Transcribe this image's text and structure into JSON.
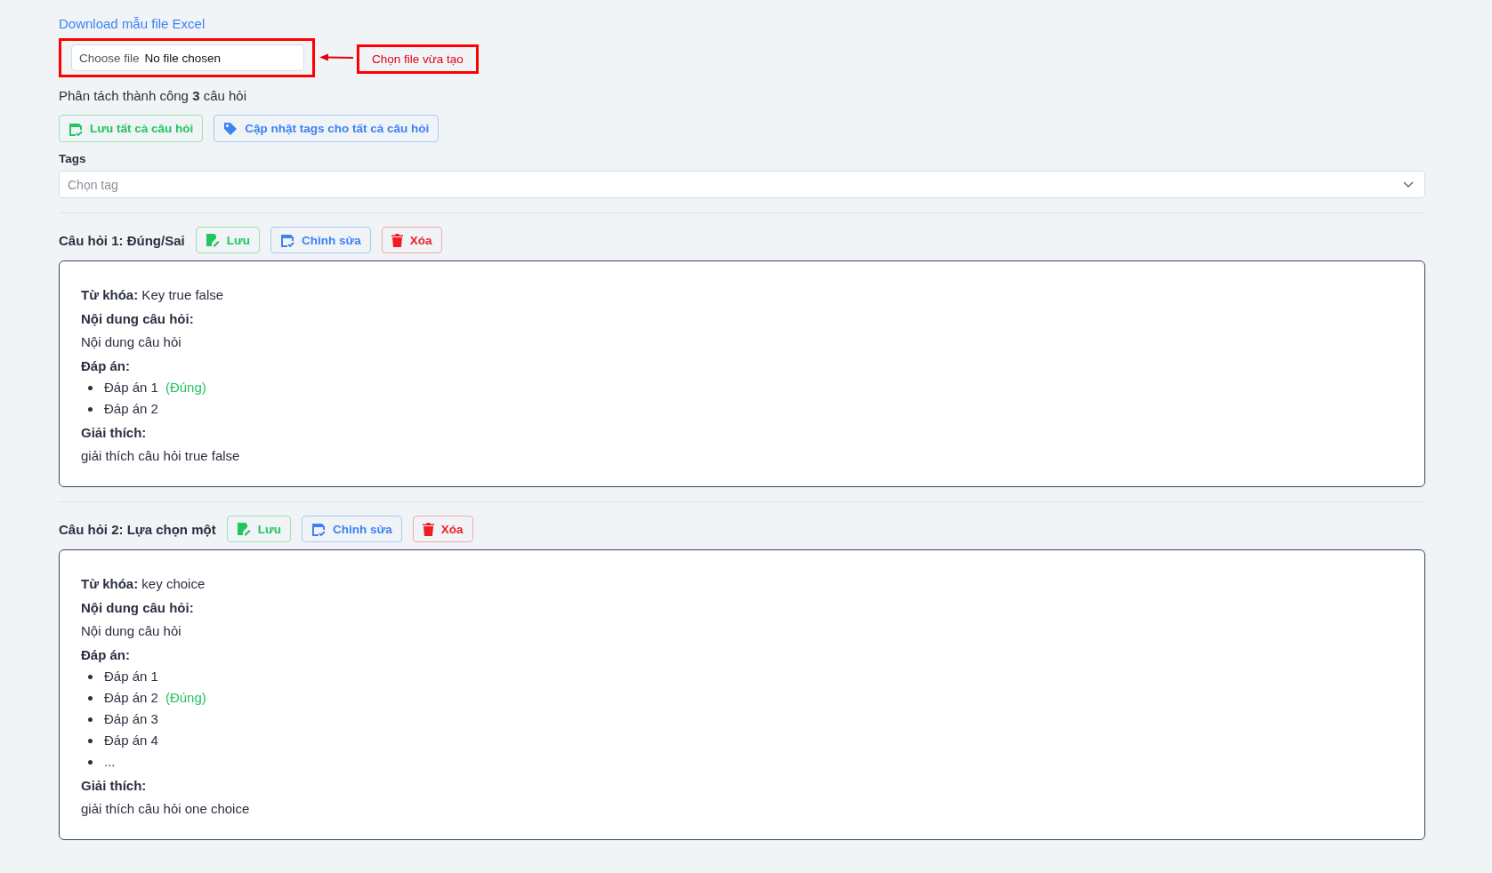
{
  "download_link": "Download mẫu file Excel",
  "file_input": {
    "button": "Choose file",
    "value": "No file chosen"
  },
  "annotation": {
    "text": "Chọn file vừa tạo"
  },
  "result_text": "Phân tách thành công **3** câu hỏi",
  "bulk_buttons": [
    {
      "kind": "save",
      "label": "Lưu tất cả câu hỏi"
    },
    {
      "kind": "tag",
      "label": "Cập nhật tags cho tất cả câu hỏi"
    }
  ],
  "tags": {
    "label": "Tags",
    "placeholder": "Chọn tag"
  },
  "questions": [
    {
      "title": "Câu hỏi 1: Đúng/Sai",
      "buttons": [
        {
          "kind": "save",
          "label": "Lưu"
        },
        {
          "kind": "edit",
          "label": "Chỉnh sửa"
        },
        {
          "kind": "delete",
          "label": "Xóa"
        }
      ],
      "keyword": "**Từ khóa:** Key true false",
      "content_label": "Nội dung câu hỏi:",
      "content": "Nội dung câu hỏi",
      "answers_label": "Đáp án:",
      "answers": [
        {
          "text": "Đáp án 1",
          "tag": "(Đúng)"
        },
        {
          "text": "Đáp án 2"
        }
      ],
      "explanation_label": "Giải thích:",
      "explanation": "giải thích câu hỏi true false"
    },
    {
      "title": "Câu hỏi 2: Lựa chọn một",
      "buttons": [
        {
          "kind": "save",
          "label": "Lưu"
        },
        {
          "kind": "edit",
          "label": "Chỉnh sửa"
        },
        {
          "kind": "delete",
          "label": "Xóa"
        }
      ],
      "keyword": "**Từ khóa:** key choice",
      "content_label": "Nội dung câu hỏi:",
      "content": "Nội dung câu hỏi",
      "answers_label": "Đáp án:",
      "answers": [
        {
          "text": "Đáp án 1"
        },
        {
          "text": "Đáp án 2",
          "tag": "(Đúng)"
        },
        {
          "text": "Đáp án 3"
        },
        {
          "text": "Đáp án 4"
        },
        {
          "text": "..."
        }
      ],
      "explanation_label": "Giải thích:",
      "explanation": "giải thích câu hỏi one choice"
    }
  ]
}
